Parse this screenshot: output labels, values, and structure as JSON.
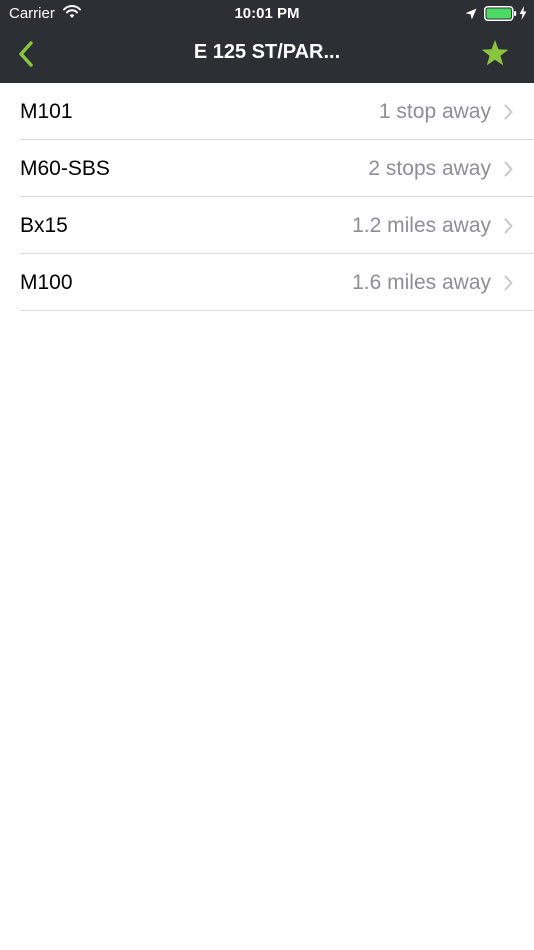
{
  "colors": {
    "header_background": "#2c2f33",
    "accent_green": "#8ac53f",
    "secondary_text": "#8e8e93",
    "separator": "#dcdcdf"
  },
  "status_bar": {
    "carrier": "Carrier",
    "time": "10:01 PM",
    "icons": [
      "wifi-icon",
      "location-arrow-icon",
      "battery-icon",
      "charging-bolt-icon"
    ]
  },
  "nav": {
    "title": "E 125 ST/PAR...",
    "back_icon": "chevron-left-icon",
    "favorite_icon": "star-icon"
  },
  "routes": [
    {
      "name": "M101",
      "distance": "1 stop away"
    },
    {
      "name": "M60-SBS",
      "distance": "2 stops away"
    },
    {
      "name": "Bx15",
      "distance": "1.2 miles away"
    },
    {
      "name": "M100",
      "distance": "1.6 miles away"
    }
  ]
}
